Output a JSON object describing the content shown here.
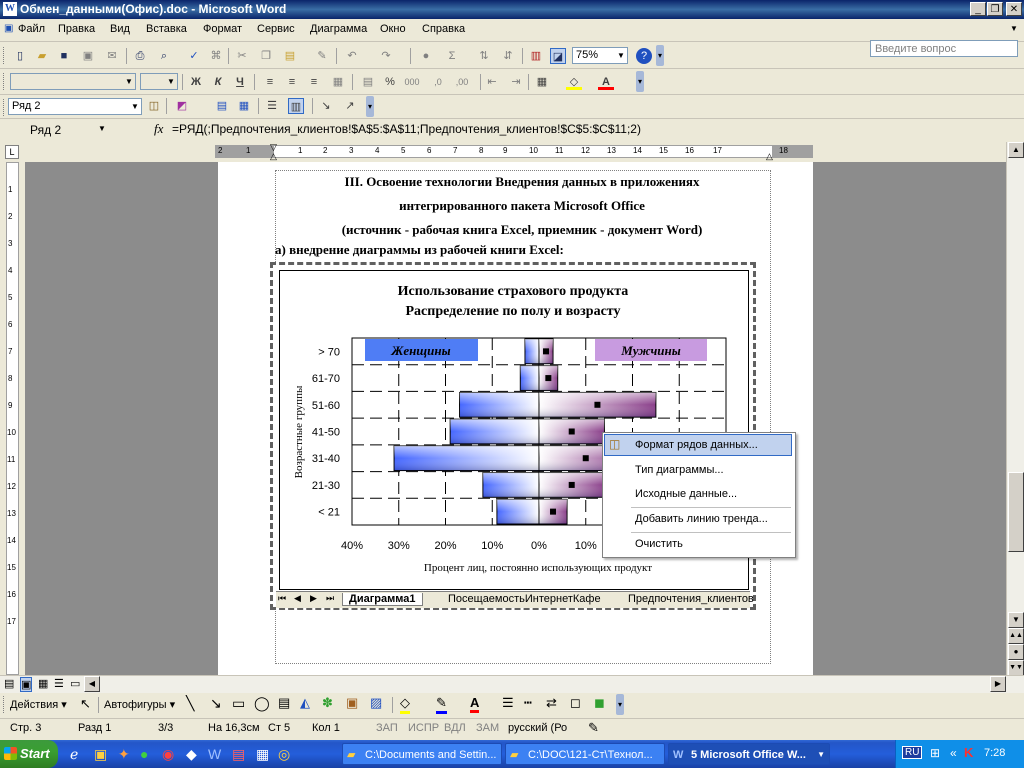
{
  "window": {
    "title": "Обмен_данными(Офис).doc - Microsoft Word",
    "buttons": [
      "_",
      "❐",
      "✕"
    ]
  },
  "menu": {
    "items": [
      "Файл",
      "Правка",
      "Вид",
      "Вставка",
      "Формат",
      "Сервис",
      "Диаграмма",
      "Окно",
      "Справка"
    ],
    "ask_placeholder": "Введите вопрос"
  },
  "toolbar": {
    "zoom": "75%"
  },
  "toolbar2": {
    "font": "",
    "size": "",
    "bold": "Ж",
    "italic": "К",
    "underline": "Ч",
    "percent": "%"
  },
  "chart_toolbar": {
    "object": "Ряд 2"
  },
  "formula_bar": {
    "name": "Ряд 2",
    "fx": "fx",
    "formula": "=РЯД(;Предпочтения_клиентов!$A$5:$A$11;Предпочтения_клиентов!$C$5:$C$11;2)"
  },
  "ruler": {
    "numbers": [
      "2",
      "1",
      "1",
      "2",
      "3",
      "4",
      "5",
      "6",
      "7",
      "8",
      "9",
      "10",
      "11",
      "12",
      "13",
      "14",
      "15",
      "16",
      "17",
      "18"
    ]
  },
  "vruler": {
    "numbers": [
      "1",
      "2",
      "3",
      "4",
      "5",
      "6",
      "7",
      "8",
      "9",
      "10",
      "11",
      "12",
      "13",
      "14",
      "15",
      "16",
      "17"
    ]
  },
  "document": {
    "heading_lines": [
      "III. Освоение технологии Внедрения данных в приложениях",
      "интегрированного пакета Microsoft Office",
      "(источник - рабочая книга Excel, приемник - документ Word)"
    ],
    "subheading": "а) внедрение диаграммы из рабочей книги Excel:"
  },
  "chart_data": {
    "type": "bar",
    "orientation": "horizontal-population-pyramid",
    "title": "Использование страхового продукта",
    "subtitle": "Распределение по полу и возрасту",
    "categories": [
      "< 21",
      "21-30",
      "31-40",
      "41-50",
      "51-60",
      "61-70",
      "> 70"
    ],
    "series": [
      {
        "name": "Женщины",
        "values": [
          9,
          12,
          31,
          19,
          17,
          4,
          3
        ],
        "color": "#6f8cff"
      },
      {
        "name": "Мужчины",
        "values": [
          6,
          14,
          20,
          14,
          25,
          4,
          3
        ],
        "color": "#a868b0"
      }
    ],
    "xlabel": "Процент лиц, постоянно использующих продукт",
    "ylabel": "Возрастные группы",
    "xticks": [
      "40%",
      "30%",
      "20%",
      "10%",
      "0%",
      "10%",
      "20%",
      "30%",
      "40%"
    ],
    "xlim": [
      -40,
      40
    ],
    "grid": true,
    "legend": "top, as labels over each side"
  },
  "sheet_tabs": {
    "nav": [
      "⏮",
      "◀",
      "▶",
      "⏭"
    ],
    "tabs": [
      "Диаграмма1",
      "ПосещаемостьИнтернетКафе",
      "Предпочтения_клиентов"
    ]
  },
  "context_menu": {
    "items": [
      "Формат рядов данных...",
      "Тип диаграммы...",
      "Исходные данные...",
      "Добавить линию тренда...",
      "Очистить"
    ]
  },
  "drawbar": {
    "actions": "Действия",
    "autoshapes": "Автофигуры"
  },
  "status": {
    "page": "Стр. 3",
    "section": "Разд 1",
    "pages": "3/3",
    "at": "На 16,3см",
    "line": "Ст 5",
    "col": "Кол 1",
    "rec": "ЗАП",
    "trk": "ИСПР",
    "ext": "ВДЛ",
    "ovr": "ЗАМ",
    "lang": "русский (Ро"
  },
  "taskbar": {
    "start": "Start",
    "tasks": [
      "C:\\Documents and Settin...",
      "C:\\DOC\\121-Ст\\Технол...",
      "5 Microsoft Office W..."
    ],
    "lang": "RU",
    "clock": "7:28"
  },
  "colors": {
    "titlebar": "#0a246a",
    "taskbar": "#245edb",
    "menu_highlight": "#c1d2ee"
  }
}
